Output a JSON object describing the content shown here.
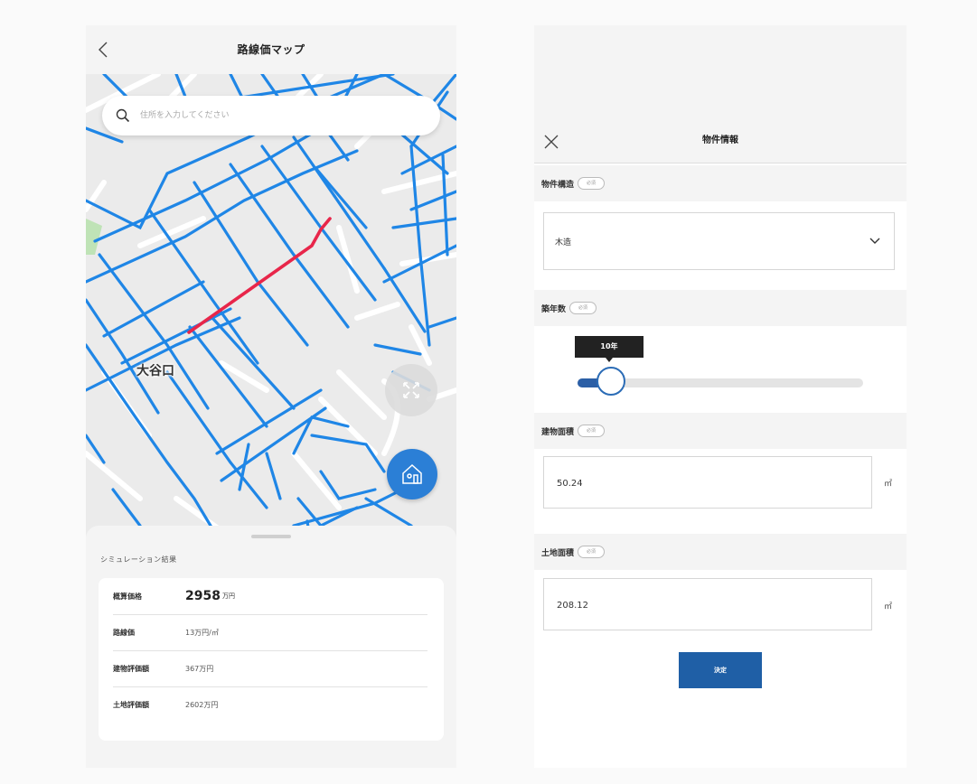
{
  "left": {
    "header": {
      "title": "路線価マップ"
    },
    "search": {
      "placeholder": "住所を入力してください"
    },
    "map": {
      "place_label": "大谷口",
      "highlight_color": "#e8264a",
      "road_color": "#1f86e6"
    },
    "sheet": {
      "title": "シミュレーション結果",
      "rows": [
        {
          "label": "概算価格",
          "value": "2958",
          "unit": "万円"
        },
        {
          "label": "路線価",
          "value": "13万円/㎡"
        },
        {
          "label": "建物評価額",
          "value": "367万円"
        },
        {
          "label": "土地評価額",
          "value": "2602万円"
        }
      ]
    }
  },
  "right": {
    "header": {
      "title": "物件情報"
    },
    "structure": {
      "label": "物件構造",
      "required": "必須",
      "value": "木造"
    },
    "age": {
      "label": "築年数",
      "required": "必須",
      "value_label": "10年",
      "fill_fraction": 0.1
    },
    "building_area": {
      "label": "建物面積",
      "required": "必須",
      "value": "50.24",
      "unit": "㎡"
    },
    "land_area": {
      "label": "土地面積",
      "required": "必須",
      "value": "208.12",
      "unit": "㎡"
    },
    "submit_label": "決定"
  }
}
